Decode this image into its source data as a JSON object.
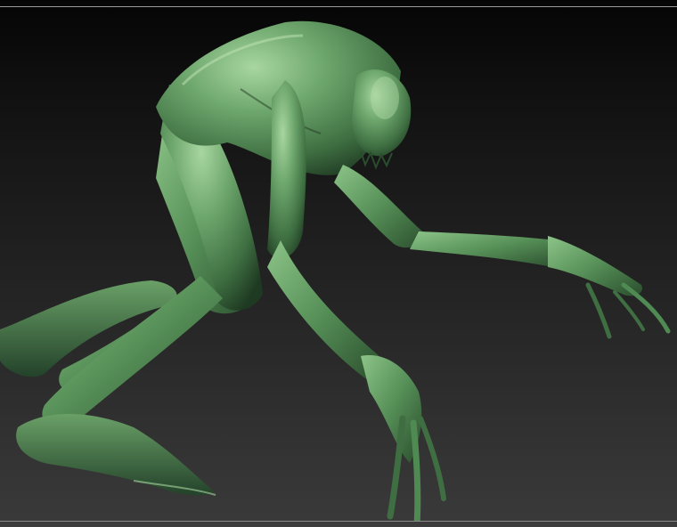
{
  "viewport": {
    "background_top": "#050505",
    "background_bottom": "#3a3a3a",
    "border_color": "#9a9a9a"
  },
  "model": {
    "subject": "creature-sculpt",
    "material_base": "#4f8a52",
    "material_highlight": "#a8d6a0",
    "material_shadow": "#1f3a22"
  }
}
